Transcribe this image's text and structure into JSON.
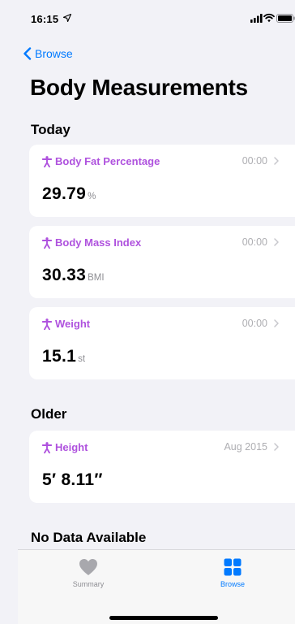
{
  "status_bar": {
    "time": "16:15"
  },
  "nav": {
    "back_label": "Browse"
  },
  "page": {
    "title": "Body Measurements"
  },
  "sections": {
    "today": "Today",
    "older": "Older",
    "no_data": "No Data Available"
  },
  "cards": {
    "body_fat": {
      "label": "Body Fat Percentage",
      "time": "00:00",
      "value": "29.79",
      "unit": "%"
    },
    "bmi": {
      "label": "Body Mass Index",
      "time": "00:00",
      "value": "30.33",
      "unit": "BMI"
    },
    "weight": {
      "label": "Weight",
      "time": "00:00",
      "value": "15.1",
      "unit": "st"
    },
    "height": {
      "label": "Height",
      "time": "Aug 2015",
      "value": "5′ 8.11″",
      "unit": ""
    }
  },
  "tab_bar": {
    "summary_label": "Summary",
    "browse_label": "Browse"
  },
  "colors": {
    "accent_blue": "#007aff",
    "category_purple": "#af52de",
    "background": "#f2f2f7",
    "inactive_gray": "#a8a8ad"
  },
  "icons": {
    "location": "location-arrow-icon",
    "signal": "cellular-signal-icon",
    "wifi": "wifi-icon",
    "battery": "battery-icon",
    "back": "chevron-left-icon",
    "category": "person-figure-icon",
    "disclosure": "chevron-right-icon",
    "summary_tab": "heart-icon",
    "browse_tab": "grid-icon"
  }
}
